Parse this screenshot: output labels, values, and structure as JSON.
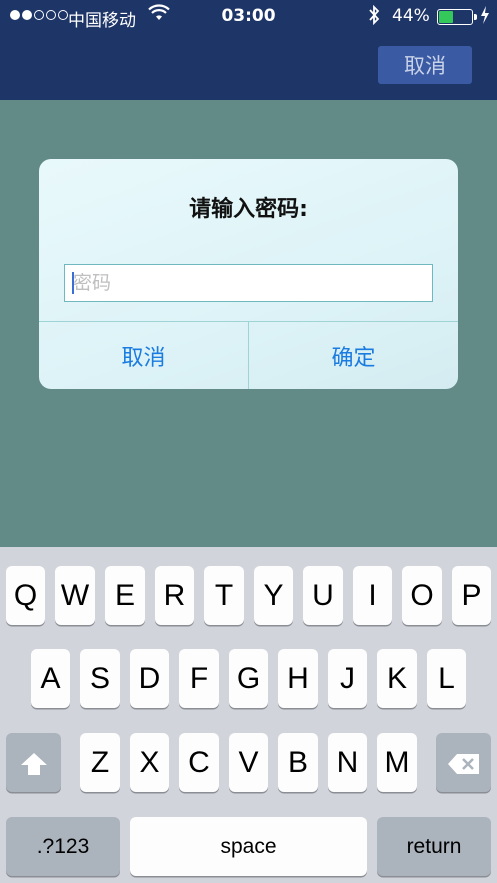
{
  "status_bar": {
    "carrier": "中国移动",
    "time": "03:00",
    "battery_pct": "44%",
    "battery_level": 0.44,
    "signal_bars": 2
  },
  "nav": {
    "cancel_label": "取消"
  },
  "dialog": {
    "title": "请输入密码:",
    "password_placeholder": "密码",
    "password_value": "",
    "cancel_label": "取消",
    "ok_label": "确定"
  },
  "keyboard": {
    "row1": [
      "Q",
      "W",
      "E",
      "R",
      "T",
      "Y",
      "U",
      "I",
      "O",
      "P"
    ],
    "row2": [
      "A",
      "S",
      "D",
      "F",
      "G",
      "H",
      "J",
      "K",
      "L"
    ],
    "row3": [
      "Z",
      "X",
      "C",
      "V",
      "B",
      "N",
      "M"
    ],
    "numbers_label": ".?123",
    "space_label": "space",
    "return_label": "return"
  },
  "colors": {
    "nav_bg": "#1e3568",
    "backdrop": "#628a86",
    "accent": "#1a7be0",
    "battery": "#34c759"
  }
}
